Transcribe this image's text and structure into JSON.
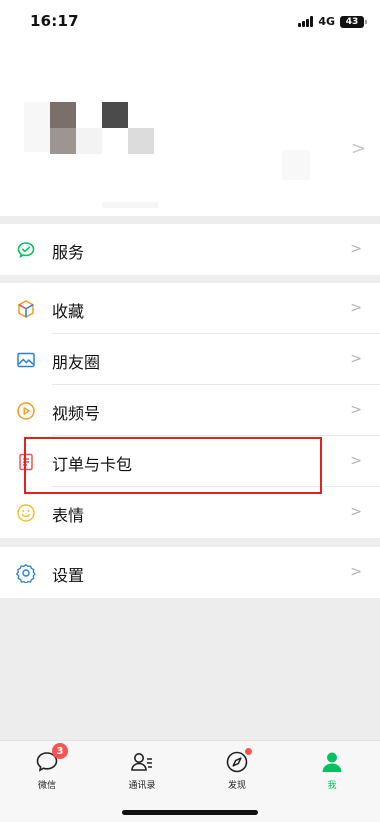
{
  "status_bar": {
    "time": "16:17",
    "network": "4G",
    "battery": "43"
  },
  "menu": {
    "service": {
      "label": "服务",
      "icon": "wechat-pay-icon",
      "color": "#07c160"
    },
    "main_items": [
      {
        "label": "收藏",
        "icon": "favorites-cube-icon"
      },
      {
        "label": "朋友圈",
        "icon": "moments-image-icon"
      },
      {
        "label": "视频号",
        "icon": "channels-play-icon"
      },
      {
        "label": "订单与卡包",
        "icon": "orders-wallet-icon"
      },
      {
        "label": "表情",
        "icon": "sticker-smile-icon"
      }
    ],
    "settings": {
      "label": "设置",
      "icon": "gear-icon"
    },
    "chevron": ">"
  },
  "tabbar": {
    "tabs": [
      {
        "label": "微信",
        "icon": "chat-bubble-icon",
        "badge": "3"
      },
      {
        "label": "通讯录",
        "icon": "contacts-icon"
      },
      {
        "label": "发现",
        "icon": "compass-icon",
        "dot": true
      },
      {
        "label": "我",
        "icon": "person-icon",
        "active": true
      }
    ],
    "active_color": "#07c160"
  },
  "highlight_color": "#e3221a"
}
